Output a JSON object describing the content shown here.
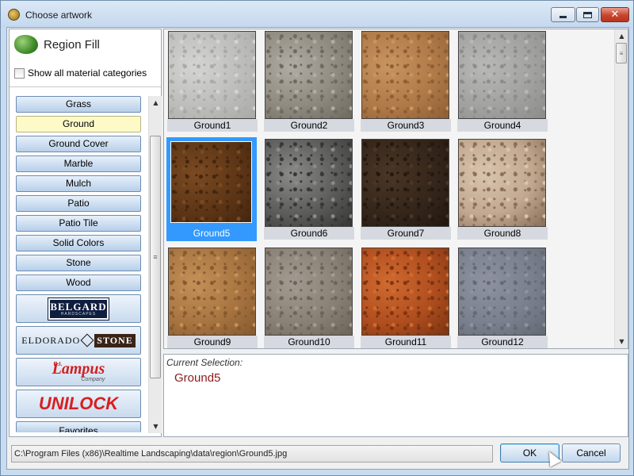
{
  "window": {
    "title": "Choose artwork"
  },
  "panel": {
    "region_title": "Region Fill",
    "show_all_label": "Show all material categories",
    "show_all_checked": false,
    "categories": [
      {
        "label": "Grass",
        "selected": false
      },
      {
        "label": "Ground",
        "selected": true
      },
      {
        "label": "Ground Cover",
        "selected": false
      },
      {
        "label": "Marble",
        "selected": false
      },
      {
        "label": "Mulch",
        "selected": false
      },
      {
        "label": "Patio",
        "selected": false
      },
      {
        "label": "Patio Tile",
        "selected": false
      },
      {
        "label": "Solid Colors",
        "selected": false
      },
      {
        "label": "Stone",
        "selected": false
      },
      {
        "label": "Wood",
        "selected": false
      }
    ],
    "brands": {
      "belgard": "BELGARD",
      "belgard_sub": "HARDSCAPES",
      "eldorado": "ELDORADO",
      "eldorado_stone": "STONE",
      "lampus_ri": "R.I.",
      "lampus": "Lampus",
      "lampus_co": "Company",
      "unilock": "UNILOCK"
    },
    "favorites_label": "Favorites"
  },
  "tiles": [
    {
      "label": "Ground1",
      "selected": false,
      "colors": [
        "#d4d4d2",
        "#bdbdbb",
        "#a9a9a6"
      ]
    },
    {
      "label": "Ground2",
      "selected": false,
      "colors": [
        "#b0aca3",
        "#8f8a80",
        "#6f6a60"
      ]
    },
    {
      "label": "Ground3",
      "selected": false,
      "colors": [
        "#c89460",
        "#b07a48",
        "#8e5e34"
      ]
    },
    {
      "label": "Ground4",
      "selected": false,
      "colors": [
        "#b8b8b6",
        "#a2a2a0",
        "#8c8c8a"
      ]
    },
    {
      "label": "Ground5",
      "selected": true,
      "colors": [
        "#7a4a22",
        "#5e3616",
        "#44260e"
      ]
    },
    {
      "label": "Ground6",
      "selected": false,
      "colors": [
        "#8a8a88",
        "#5c5c5a",
        "#363636"
      ]
    },
    {
      "label": "Ground7",
      "selected": false,
      "colors": [
        "#4a3626",
        "#35261a",
        "#221810"
      ]
    },
    {
      "label": "Ground8",
      "selected": false,
      "colors": [
        "#d8c4ae",
        "#c2a88e",
        "#8a6e58"
      ]
    },
    {
      "label": "Ground9",
      "selected": false,
      "colors": [
        "#c49058",
        "#a87440",
        "#855a30"
      ]
    },
    {
      "label": "Ground10",
      "selected": false,
      "colors": [
        "#a29a90",
        "#8a8176",
        "#6c645a"
      ]
    },
    {
      "label": "Ground11",
      "selected": false,
      "colors": [
        "#d06a30",
        "#b04e1e",
        "#7c3412"
      ]
    },
    {
      "label": "Ground12",
      "selected": false,
      "colors": [
        "#8e92a0",
        "#7a808e",
        "#646a74"
      ]
    }
  ],
  "current_selection": {
    "label": "Current Selection:",
    "value": "Ground5"
  },
  "path": "C:\\Program Files (x86)\\Realtime Landscaping\\data\\region\\Ground5.jpg",
  "buttons": {
    "ok": "OK",
    "cancel": "Cancel"
  }
}
